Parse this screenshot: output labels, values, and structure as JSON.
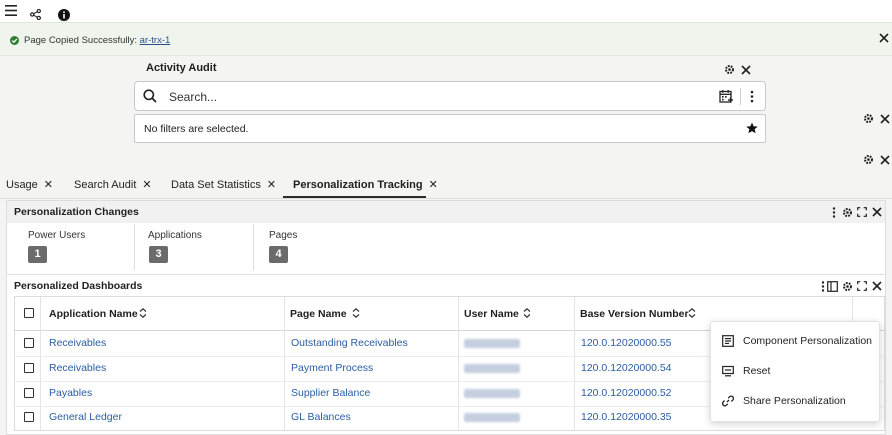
{
  "notice": {
    "message": "Page Copied Successfully: ",
    "link": "ar-trx-1"
  },
  "activity_audit": {
    "title": "Activity Audit",
    "search_placeholder": "Search...",
    "filters_text": "No filters are selected."
  },
  "tabs": [
    {
      "label": "Usage"
    },
    {
      "label": "Search Audit"
    },
    {
      "label": "Data Set Statistics"
    },
    {
      "label": "Personalization Tracking",
      "active": true
    }
  ],
  "personalization_changes": {
    "title": "Personalization Changes",
    "metrics": [
      {
        "label": "Power Users",
        "value": "1"
      },
      {
        "label": "Applications",
        "value": "3"
      },
      {
        "label": "Pages",
        "value": "4"
      }
    ]
  },
  "personalized_dashboards": {
    "title": "Personalized Dashboards",
    "columns": [
      "Application Name",
      "Page Name",
      "User Name",
      "Base Version Number"
    ],
    "rows": [
      {
        "application": "Receivables",
        "page": "Outstanding Receivables",
        "version": "120.0.12020000.55"
      },
      {
        "application": "Receivables",
        "page": "Payment Process",
        "version": "120.0.12020000.54"
      },
      {
        "application": "Payables",
        "page": "Supplier Balance",
        "version": "120.0.12020000.52"
      },
      {
        "application": "General Ledger",
        "page": "GL Balances",
        "version": "120.0.12020000.35"
      }
    ]
  },
  "context_menu": {
    "items": [
      {
        "label": "Component Personalization",
        "icon": "component-personalization-icon"
      },
      {
        "label": "Reset",
        "icon": "reset-icon"
      },
      {
        "label": "Share Personalization",
        "icon": "link-icon"
      }
    ]
  },
  "colors": {
    "link": "#2a5ea3",
    "badge": "#6b6b6b",
    "success": "#2e7d32"
  }
}
